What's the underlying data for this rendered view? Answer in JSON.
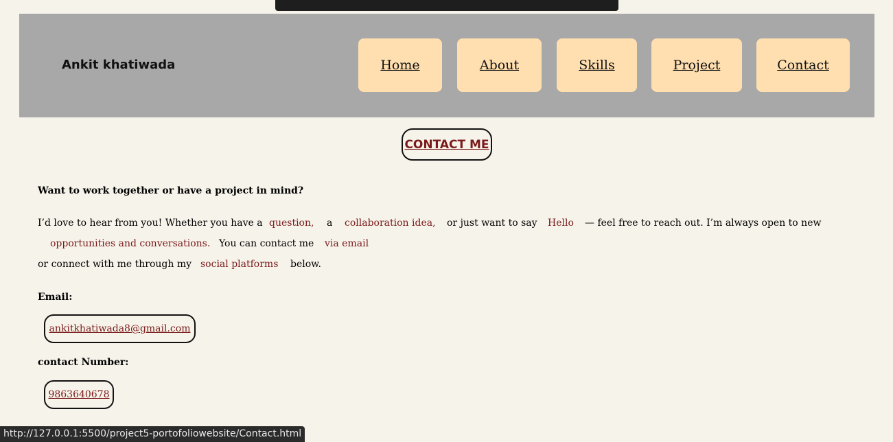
{
  "header": {
    "brand": "Ankit khatiwada",
    "nav": [
      "Home",
      "About",
      "Skills",
      "Project",
      "Contact"
    ]
  },
  "main": {
    "title": "CONTACT ME",
    "intro_heading": "Want to work together or have a project in mind?",
    "para": {
      "p1": "I’d love to hear from you! Whether you have a",
      "h1": "question,",
      "p2": "a",
      "h2": "collaboration idea,",
      "p3": "or just want to say",
      "h3": "Hello",
      "p4": "— feel free to reach out. I’m always open to new",
      "h4": "opportunities and conversations.",
      "p5": "You can contact me",
      "h5": "via email",
      "p6": "or connect with me through my",
      "h6": "social platforms",
      "p7": "below."
    },
    "email_label": "Email:",
    "email": "ankitkhatiwada8@gmail.com",
    "phone_label": "contact Number:",
    "phone": "9863640678"
  },
  "status_bar": {
    "url": "http://127.0.0.1:5500/project5-portofoliowebsite/Contact.html"
  },
  "colors": {
    "page_bg": "#f6f3ea",
    "header_bg": "#a8a8a8",
    "nav_button_bg": "#ffdfb0",
    "accent": "#7a1a1a"
  }
}
